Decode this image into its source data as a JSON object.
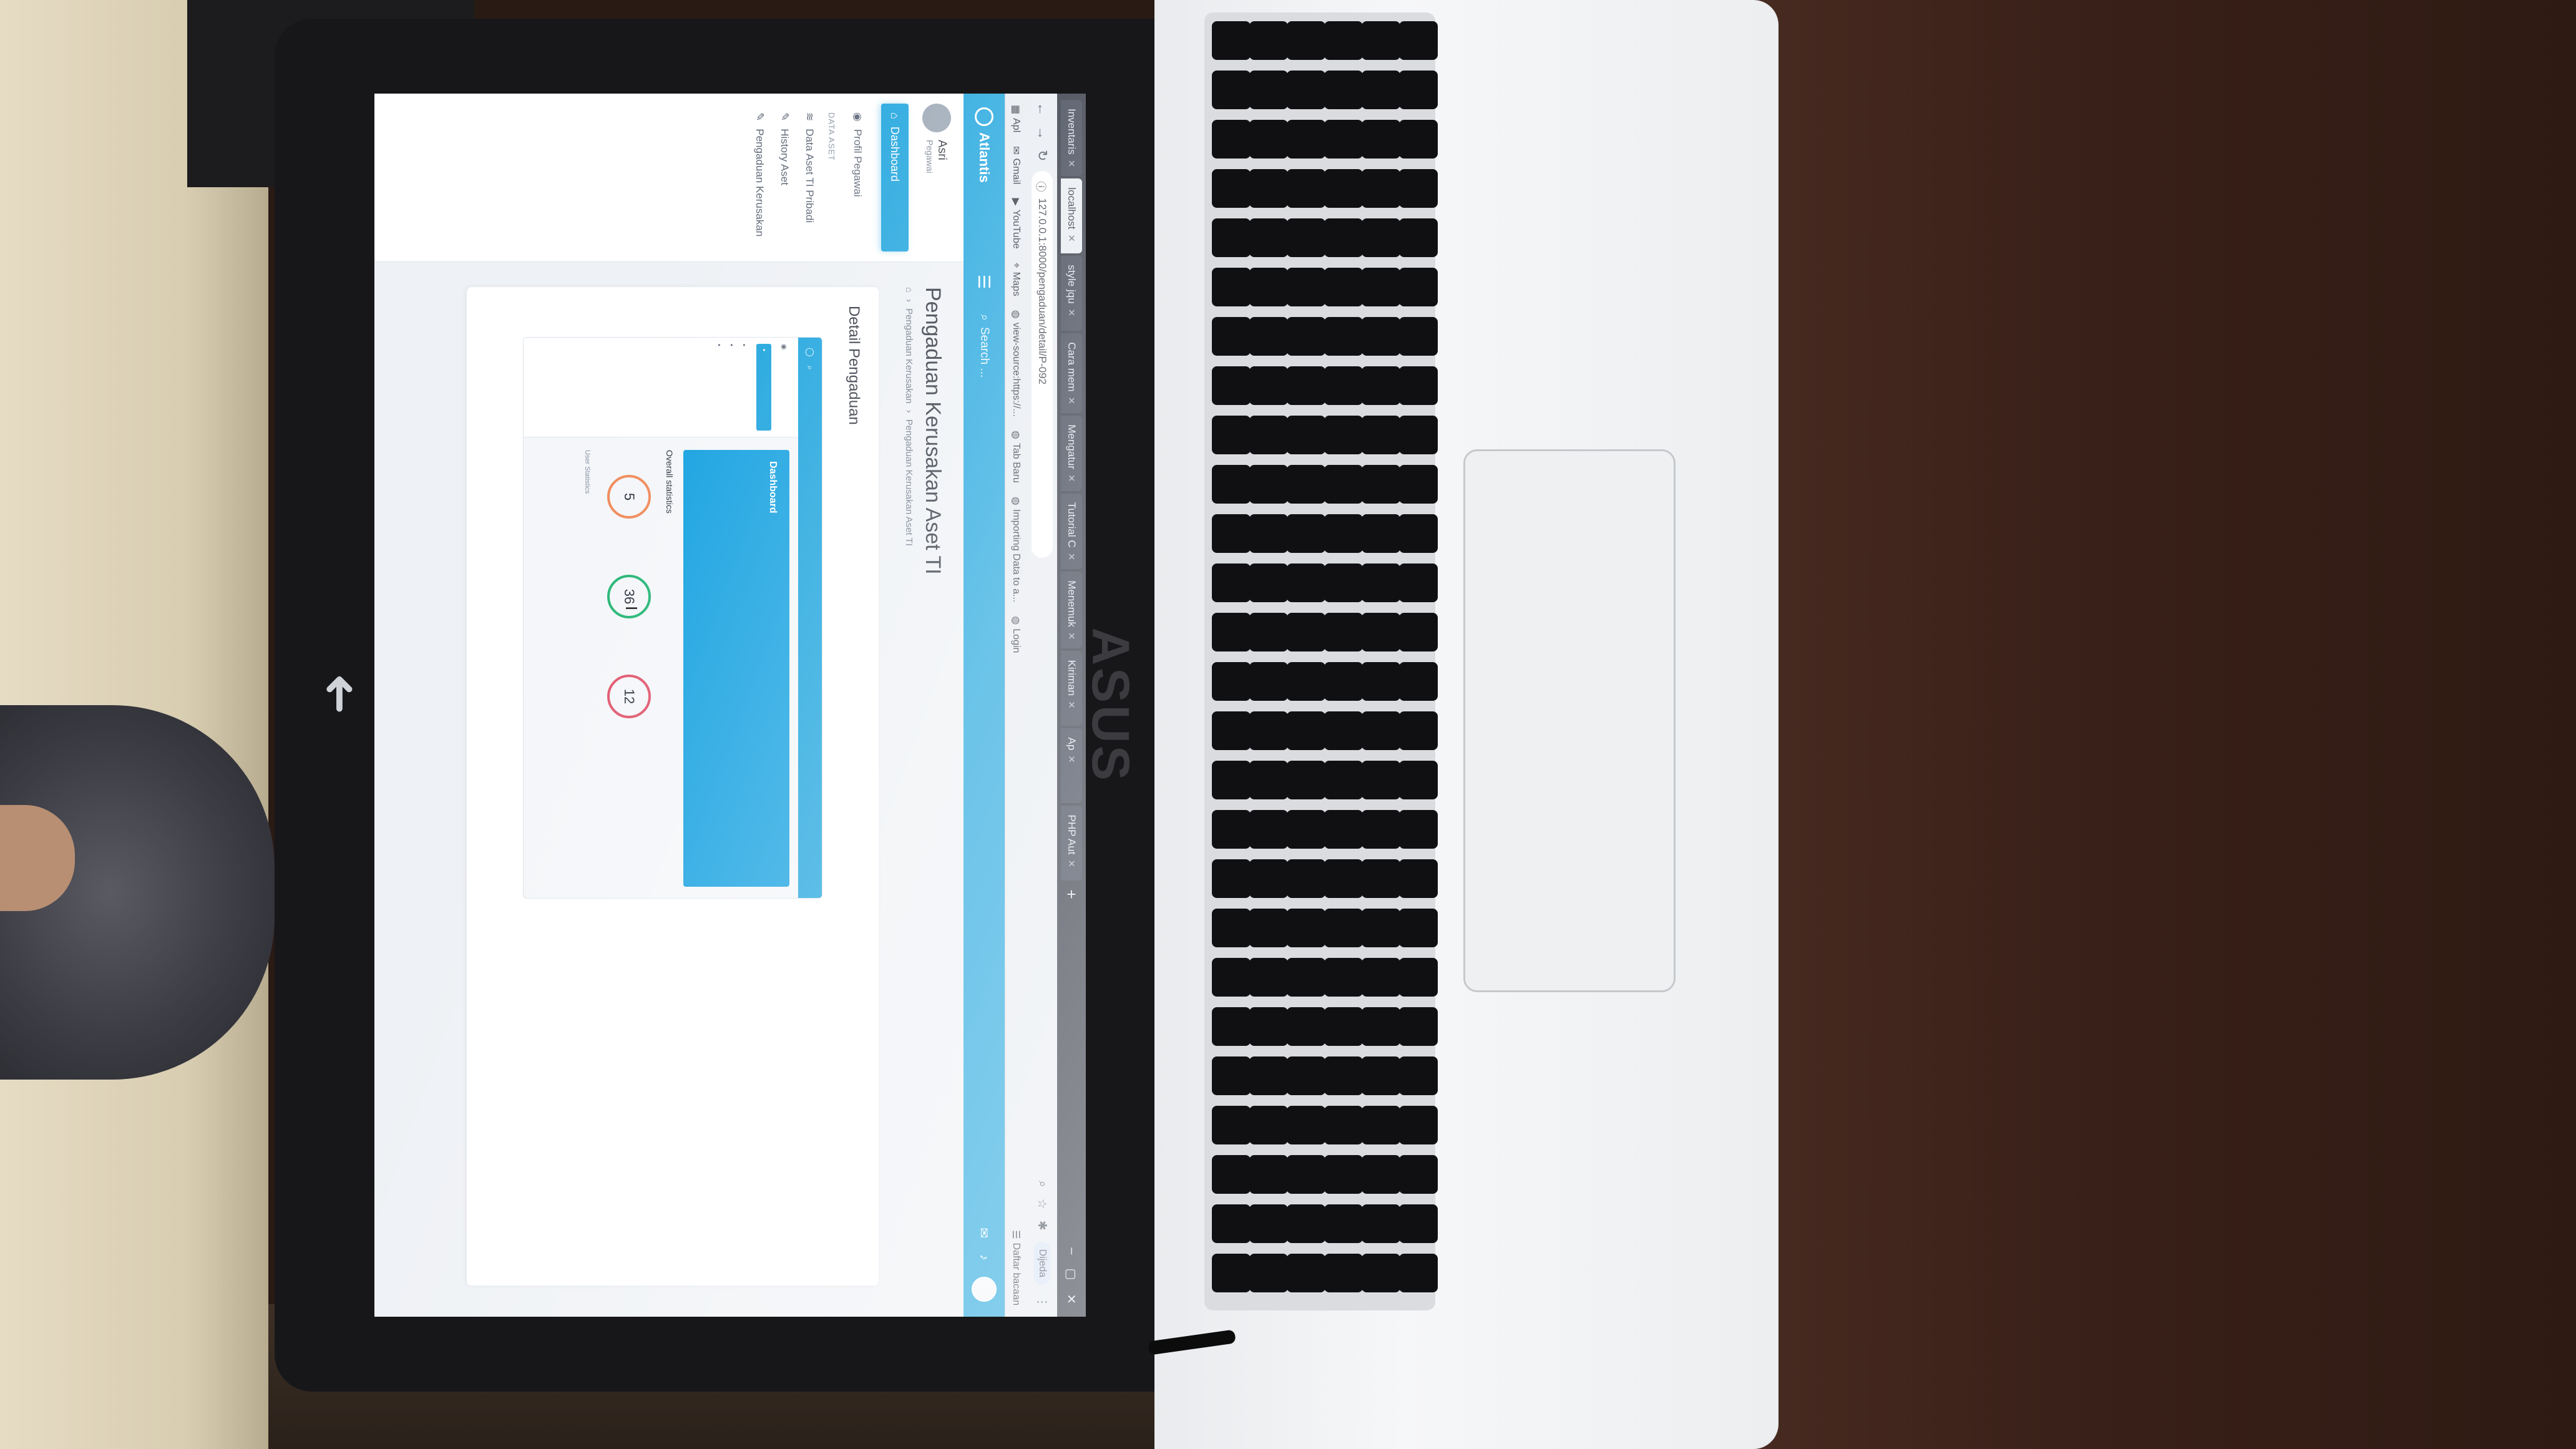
{
  "browser": {
    "tabs": [
      {
        "label": "Inventaris",
        "active": false
      },
      {
        "label": "localhost",
        "active": true
      },
      {
        "label": "style jqu",
        "active": false
      },
      {
        "label": "Cara mem",
        "active": false
      },
      {
        "label": "Mengatur",
        "active": false
      },
      {
        "label": "Tutorial C",
        "active": false
      },
      {
        "label": "Menemuk",
        "active": false
      },
      {
        "label": "Kiriman",
        "active": false
      },
      {
        "label": "Ap",
        "active": false
      },
      {
        "label": "PHP Aut",
        "active": false
      }
    ],
    "url": "127.0.0.1:8000/pengaduan/detail/P-092",
    "profile_label": "Dijeda",
    "bookmarks": [
      "Apl",
      "Gmail",
      "YouTube",
      "Maps",
      "view-source:https://...",
      "Tab Baru",
      "Importing Data to a...",
      "Login"
    ],
    "reading_list": "Daftar bacaan"
  },
  "app": {
    "brand": "Atlantis",
    "search_placeholder": "Search ...",
    "user": {
      "name": "Asri",
      "role": "Pegawai"
    },
    "nav": {
      "dashboard": "Dashboard",
      "profile": "Profil Pegawai",
      "section_label": "DATA ASET",
      "items": [
        "Data Aset TI Pribadi",
        "History Aset",
        "Pengaduan Kerusakan"
      ]
    },
    "page_title": "Pengaduan Kerusakan Aset TI",
    "breadcrumb": [
      "Pengaduan Kerusakan",
      "Pengaduan Kerusakan Aset TI"
    ],
    "card_title": "Detail Pengaduan"
  },
  "attachment": {
    "banner_title": "Dashboard",
    "section_title": "Overall statistics",
    "stats": [
      {
        "value": "5",
        "color": "#f08a5a"
      },
      {
        "value": "36",
        "color": "#22b573"
      },
      {
        "value": "12",
        "color": "#e0526a"
      }
    ],
    "footer": "User Statistics"
  },
  "laptop": {
    "logo": "ASUS"
  },
  "colors": {
    "accent": "#1aa3dd",
    "lid": "#17171a",
    "base": "#f3f4f6"
  }
}
